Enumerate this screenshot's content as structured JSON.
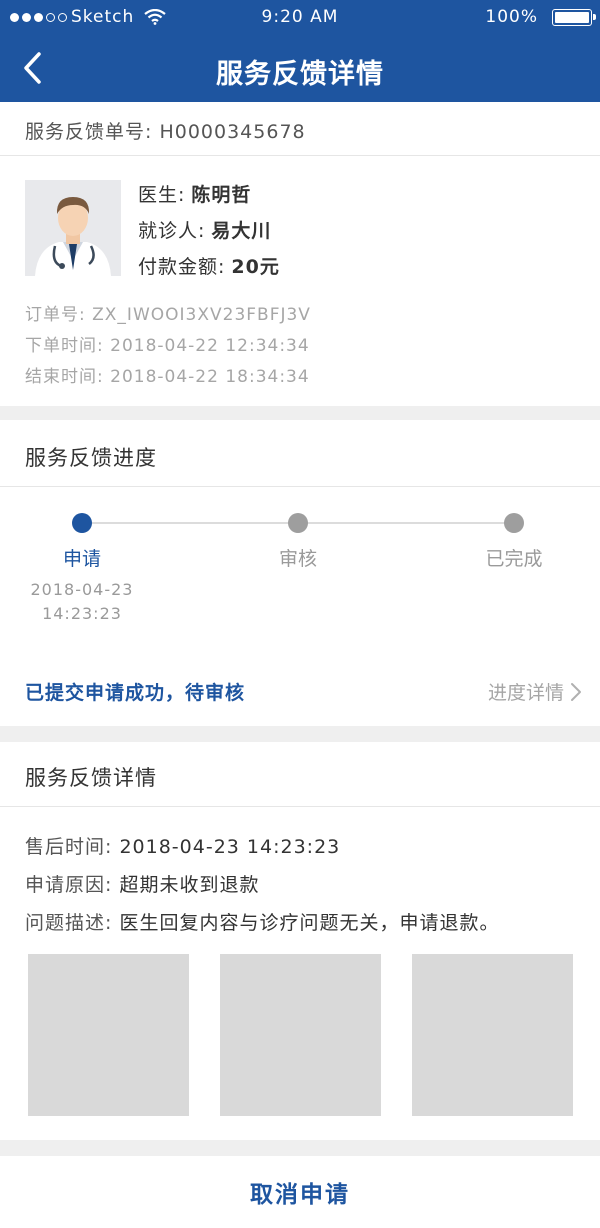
{
  "status_bar": {
    "carrier": "Sketch",
    "time": "9:20 AM",
    "battery": "100%"
  },
  "header": {
    "title": "服务反馈详情"
  },
  "feedback": {
    "number_label": "服务反馈单号:",
    "number": "H0000345678"
  },
  "info": {
    "doctor_label": "医生:",
    "doctor": "陈明哲",
    "patient_label": "就诊人:",
    "patient": "易大川",
    "amount_label": "付款金额:",
    "amount": "20元",
    "order_label": "订单号:",
    "order_no": "ZX_IWOOI3XV23FBFJ3V",
    "placed_label": "下单时间:",
    "placed_time": "2018-04-22 12:34:34",
    "ended_label": "结束时间:",
    "ended_time": "2018-04-22 18:34:34"
  },
  "progress": {
    "title": "服务反馈进度",
    "steps": [
      {
        "label": "申请",
        "active": true
      },
      {
        "label": "审核",
        "active": false
      },
      {
        "label": "已完成",
        "active": false
      }
    ],
    "step1_date": "2018-04-23",
    "step1_time": "14:23:23",
    "status_message": "已提交申请成功，待审核",
    "detail_link": "进度详情"
  },
  "details": {
    "title": "服务反馈详情",
    "time_label": "售后时间:",
    "time_value": "2018-04-23 14:23:23",
    "reason_label": "申请原因:",
    "reason_value": "超期未收到退款",
    "desc_label": "问题描述:",
    "desc_value": "医生回复内容与诊疗问题无关，申请退款。"
  },
  "actions": {
    "cancel": "取消申请"
  },
  "colors": {
    "brand": "#1e55a0",
    "inactive": "#9e9e9e",
    "placeholder": "#d9d9d9"
  }
}
